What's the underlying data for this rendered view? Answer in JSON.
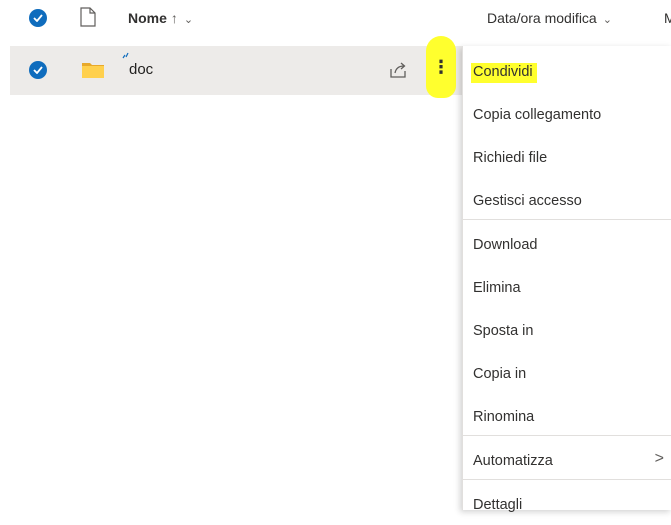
{
  "header": {
    "name_label": "Nome",
    "sort_arrow": "↑",
    "chevron": "⌄",
    "date_label": "Data/ora modifica",
    "next_col_cut": "M"
  },
  "row": {
    "name": "doc",
    "icons": [
      "folder-icon",
      "sync-indicator-icon",
      "share-icon",
      "more-icon"
    ]
  },
  "menu": {
    "items": [
      {
        "label": "Condividi"
      },
      {
        "label": "Copia collegamento"
      },
      {
        "label": "Richiedi file"
      },
      {
        "label": "Gestisci accesso"
      },
      {
        "label": "Download"
      },
      {
        "label": "Elimina"
      },
      {
        "label": "Sposta in"
      },
      {
        "label": "Copia in"
      },
      {
        "label": "Rinomina"
      },
      {
        "label": "Automatizza",
        "submenu_indicator": ">"
      },
      {
        "label": "Dettagli"
      }
    ]
  },
  "colors": {
    "accent": "#0f6cbd",
    "highlight": "#ffff2e",
    "row_selected_bg": "#edebe9",
    "folder": "#ffd04d"
  }
}
